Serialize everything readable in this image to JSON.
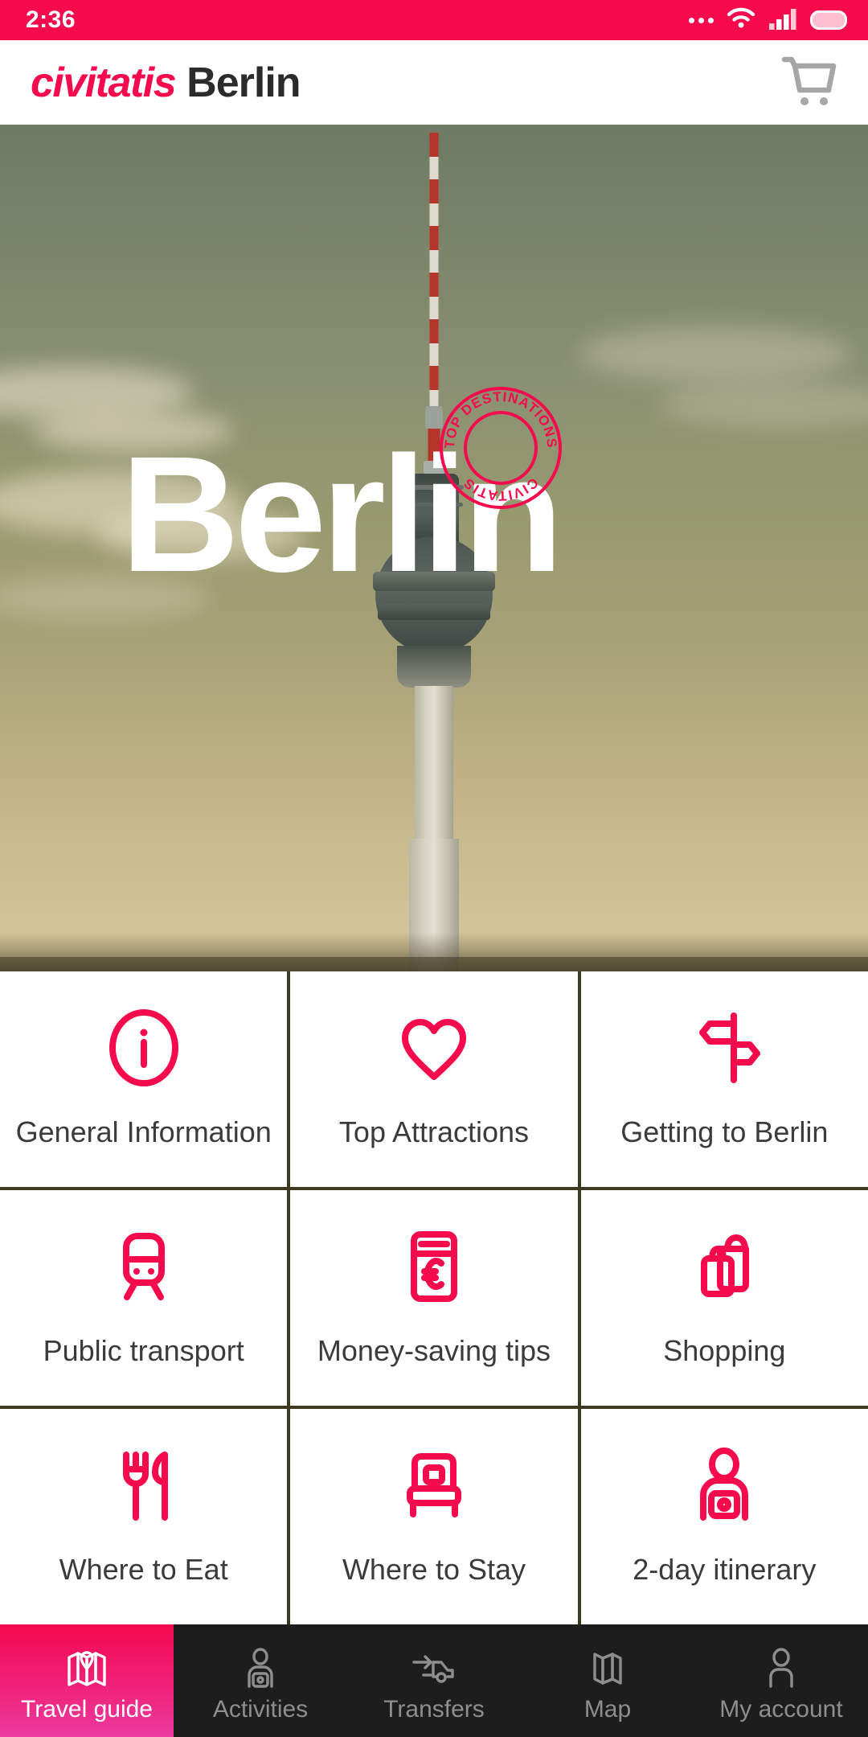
{
  "status_bar": {
    "time": "2:36",
    "background": "#F50A4E",
    "icons": [
      "more-dots-icon",
      "wifi-icon",
      "signal-icon",
      "battery-icon"
    ]
  },
  "header": {
    "brand_name": "civitatis",
    "city": "Berlin",
    "brand_color": "#F50A4E",
    "city_color": "#2B2B2B",
    "cart_icon": "shopping-cart-icon"
  },
  "hero": {
    "title": "Berlin",
    "photo_subject": "Berlin TV Tower (Fernsehturm)",
    "stamp": {
      "top_text": "TOP DESTINATIONS",
      "bottom_text": "CIVITATIS",
      "color": "#F50A4E"
    }
  },
  "grid": {
    "accent": "#F50A4E",
    "items": [
      {
        "label": "General Information",
        "icon": "info-circle-icon"
      },
      {
        "label": "Top Attractions",
        "icon": "heart-icon"
      },
      {
        "label": "Getting to Berlin",
        "icon": "signpost-icon"
      },
      {
        "label": "Public transport",
        "icon": "train-icon"
      },
      {
        "label": "Money-saving tips",
        "icon": "euro-banknote-icon"
      },
      {
        "label": "Shopping",
        "icon": "shopping-bags-icon"
      },
      {
        "label": "Where to Eat",
        "icon": "fork-knife-icon"
      },
      {
        "label": "Where to Stay",
        "icon": "bed-icon"
      },
      {
        "label": "2-day itinerary",
        "icon": "tour-guide-icon"
      }
    ]
  },
  "bottom_nav": {
    "active_index": 0,
    "active_color": "#F0217A",
    "inactive_color": "#8E8E8E",
    "items": [
      {
        "label": "Travel guide",
        "icon": "folded-map-icon"
      },
      {
        "label": "Activities",
        "icon": "tour-guide-icon"
      },
      {
        "label": "Transfers",
        "icon": "car-arrow-icon"
      },
      {
        "label": "Map",
        "icon": "map-icon"
      },
      {
        "label": "My account",
        "icon": "person-icon"
      }
    ]
  }
}
